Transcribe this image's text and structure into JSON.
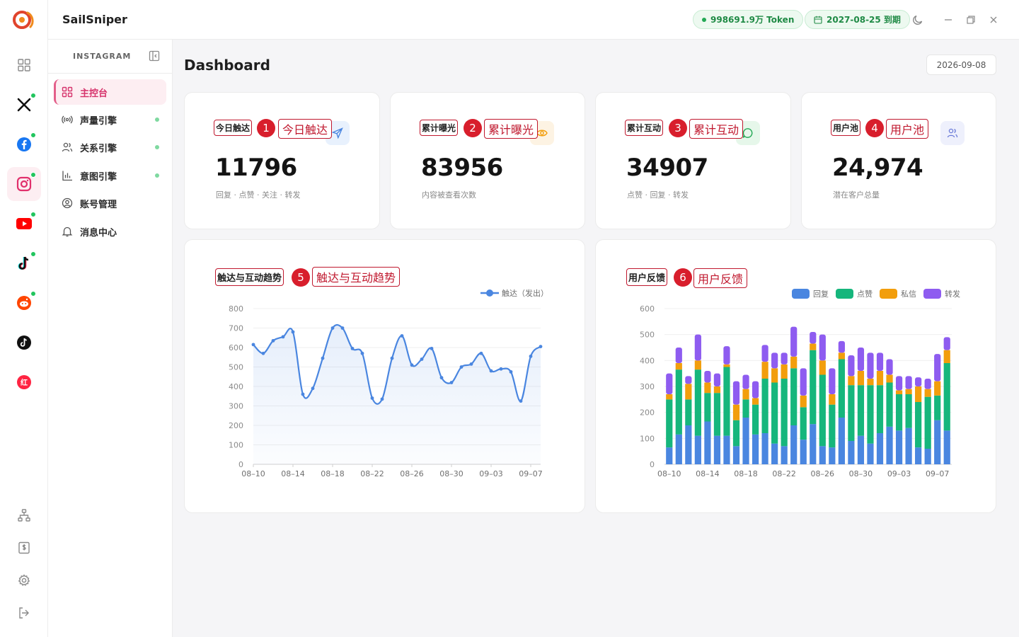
{
  "app": {
    "title": "SailSniper"
  },
  "header": {
    "token_label": "998691.9万 Token",
    "expiry_label": "2027-08-25 到期"
  },
  "rail": {
    "platforms": [
      {
        "name": "x-icon",
        "active": false,
        "dot": true
      },
      {
        "name": "facebook-icon",
        "active": false,
        "dot": true
      },
      {
        "name": "instagram-icon",
        "active": true,
        "dot": true
      },
      {
        "name": "youtube-icon",
        "active": false,
        "dot": true
      },
      {
        "name": "tiktok-icon",
        "active": false,
        "dot": true
      },
      {
        "name": "reddit-icon",
        "active": false,
        "dot": true
      },
      {
        "name": "tiktok-alt-icon",
        "active": false,
        "dot": false
      },
      {
        "name": "xiaohongshu-icon",
        "active": false,
        "dot": false
      }
    ],
    "bottom_icons": [
      "sitemap-icon",
      "billing-icon",
      "settings-icon",
      "logout-icon"
    ]
  },
  "subnav": {
    "title": "INSTAGRAM",
    "items": [
      {
        "label": "主控台",
        "icon": "dashboard-icon",
        "active": true,
        "dot": false
      },
      {
        "label": "声量引擎",
        "icon": "broadcast-icon",
        "active": false,
        "dot": true
      },
      {
        "label": "关系引擎",
        "icon": "users-icon",
        "active": false,
        "dot": true
      },
      {
        "label": "意图引擎",
        "icon": "bar-chart-icon",
        "active": false,
        "dot": true
      },
      {
        "label": "账号管理",
        "icon": "account-icon",
        "active": false,
        "dot": false
      },
      {
        "label": "消息中心",
        "icon": "bell-icon",
        "active": false,
        "dot": false
      }
    ]
  },
  "main": {
    "title": "Dashboard",
    "date": "2026-09-08",
    "stats": [
      {
        "label": "今日触达",
        "badge": "1",
        "annotation": "今日触达",
        "value": "11796",
        "sub": "回复 · 点赞 · 关注 · 转发",
        "icon": "send-icon",
        "color": "#e8f1fd"
      },
      {
        "label": "累计曝光",
        "badge": "2",
        "annotation": "累计曝光",
        "value": "83956",
        "sub": "内容被查看次数",
        "icon": "eye-icon",
        "color": "#fdf3e3"
      },
      {
        "label": "累计互动",
        "badge": "3",
        "annotation": "累计互动",
        "value": "34907",
        "sub": "点赞 · 回复 · 转发",
        "icon": "chat-icon",
        "color": "#e6f7ea"
      },
      {
        "label": "用户池",
        "badge": "4",
        "annotation": "用户池",
        "value": "24,974",
        "sub": "潜在客户总量",
        "icon": "people-icon",
        "color": "#eef0fc"
      }
    ],
    "trend": {
      "label": "触达与互动趋势",
      "badge": "5",
      "annotation": "触达与互动趋势"
    },
    "feedback": {
      "label": "用户反馈",
      "badge": "6",
      "annotation": "用户反馈"
    }
  },
  "chart_data": [
    {
      "type": "line",
      "title": "触达与互动趋势",
      "ylim": [
        0,
        800
      ],
      "yticks": [
        0,
        100,
        200,
        300,
        400,
        500,
        600,
        700,
        800
      ],
      "x_tick_labels": [
        "08–10",
        "08–14",
        "08–18",
        "08–22",
        "08–26",
        "08–30",
        "09–03",
        "09–07"
      ],
      "x": [
        "08-10",
        "08-11",
        "08-12",
        "08-13",
        "08-14",
        "08-15",
        "08-16",
        "08-17",
        "08-18",
        "08-19",
        "08-20",
        "08-21",
        "08-22",
        "08-23",
        "08-24",
        "08-25",
        "08-26",
        "08-27",
        "08-28",
        "08-29",
        "08-30",
        "08-31",
        "09-01",
        "09-02",
        "09-03",
        "09-04",
        "09-05",
        "09-06",
        "09-07",
        "09-08"
      ],
      "series": [
        {
          "name": "触达（发出）",
          "color": "#4a86e0",
          "values": [
            615,
            570,
            635,
            655,
            680,
            360,
            390,
            545,
            700,
            700,
            595,
            570,
            340,
            335,
            545,
            660,
            510,
            540,
            595,
            445,
            420,
            500,
            515,
            570,
            480,
            490,
            475,
            325,
            555,
            605
          ]
        }
      ],
      "grid": true,
      "legend": "top-right"
    },
    {
      "type": "bar",
      "stacked": true,
      "title": "用户反馈",
      "ylim": [
        0,
        600
      ],
      "yticks": [
        0,
        100,
        200,
        300,
        400,
        500,
        600
      ],
      "x_tick_labels": [
        "08–10",
        "08–14",
        "08–18",
        "08–22",
        "08–26",
        "08–30",
        "09–03",
        "09–07"
      ],
      "categories": [
        "08-10",
        "08-11",
        "08-12",
        "08-13",
        "08-14",
        "08-15",
        "08-16",
        "08-17",
        "08-18",
        "08-19",
        "08-20",
        "08-21",
        "08-22",
        "08-23",
        "08-24",
        "08-25",
        "08-26",
        "08-27",
        "08-28",
        "08-29",
        "08-30",
        "08-31",
        "09-01",
        "09-02",
        "09-03",
        "09-04",
        "09-05",
        "09-06",
        "09-07",
        "09-08"
      ],
      "series": [
        {
          "name": "回复",
          "color": "#4a86e0",
          "values": [
            65,
            115,
            150,
            110,
            165,
            110,
            110,
            70,
            180,
            115,
            120,
            80,
            70,
            150,
            95,
            155,
            70,
            65,
            180,
            90,
            110,
            80,
            120,
            145,
            130,
            140,
            65,
            60,
            170,
            130
          ]
        },
        {
          "name": "点赞",
          "color": "#16b67c",
          "values": [
            185,
            250,
            100,
            255,
            110,
            165,
            265,
            100,
            70,
            115,
            210,
            235,
            260,
            220,
            125,
            285,
            275,
            165,
            225,
            215,
            195,
            225,
            185,
            170,
            140,
            130,
            175,
            200,
            95,
            260
          ]
        },
        {
          "name": "私信",
          "color": "#f29e0c",
          "values": [
            20,
            25,
            60,
            35,
            40,
            25,
            10,
            60,
            40,
            25,
            65,
            55,
            55,
            45,
            45,
            25,
            55,
            40,
            25,
            35,
            55,
            25,
            55,
            30,
            15,
            20,
            60,
            30,
            55,
            50
          ]
        },
        {
          "name": "转发",
          "color": "#8e5cf0",
          "values": [
            80,
            60,
            30,
            100,
            45,
            50,
            70,
            90,
            55,
            65,
            65,
            60,
            45,
            115,
            105,
            45,
            100,
            100,
            45,
            80,
            90,
            100,
            70,
            60,
            55,
            50,
            35,
            40,
            105,
            50
          ]
        }
      ],
      "grid": true,
      "legend": "top-right"
    }
  ]
}
